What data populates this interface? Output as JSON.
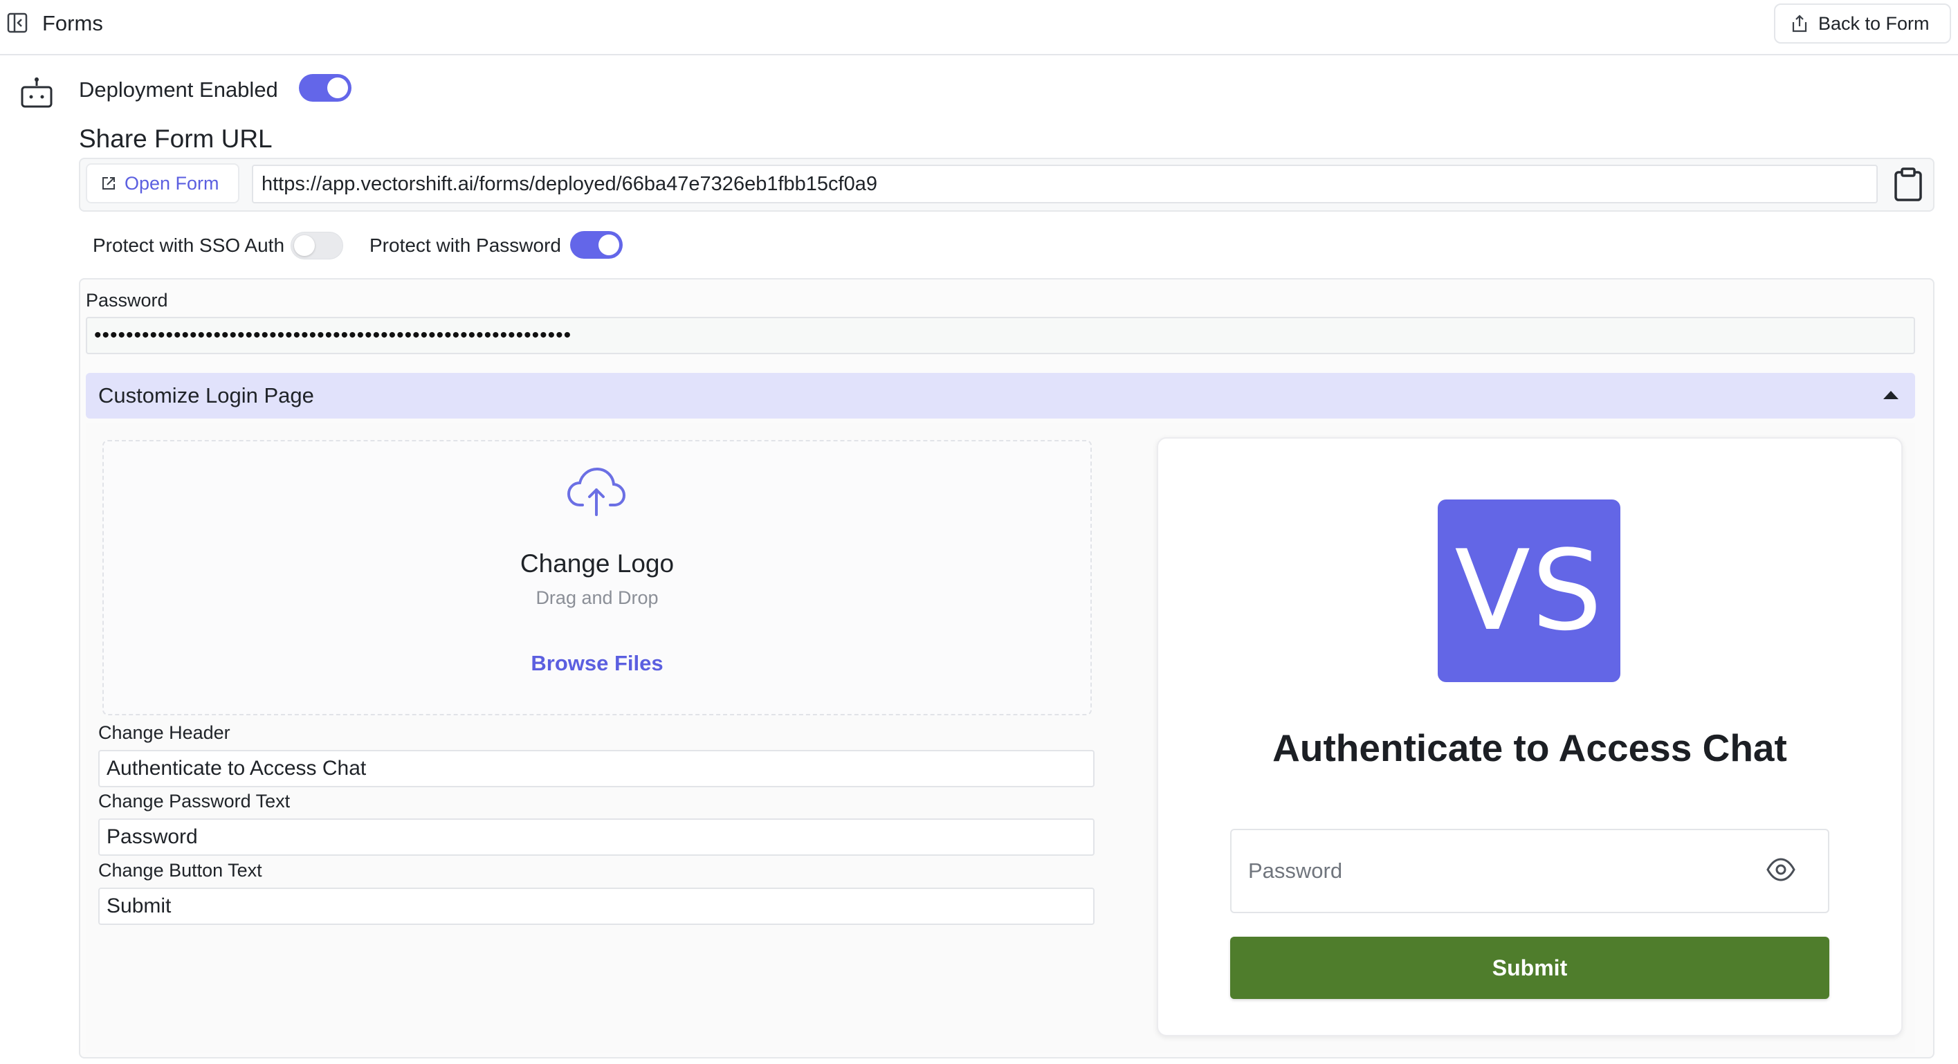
{
  "topbar": {
    "title": "Forms",
    "back_label": "Back to Form"
  },
  "deployment": {
    "label": "Deployment Enabled",
    "enabled": true
  },
  "share": {
    "title": "Share Form URL",
    "open_label": "Open Form",
    "url": "https://app.vectorshift.ai/forms/deployed/66ba47e7326eb1fbb15cf0a9"
  },
  "protection": {
    "sso_label": "Protect with SSO Auth",
    "sso_enabled": false,
    "password_label": "Protect with Password",
    "password_enabled": true
  },
  "password": {
    "caption": "Password",
    "masked_value": "••••••••••••••••••••••••••••••••••••••••••••••••••••••••••••"
  },
  "customize": {
    "title": "Customize Login Page",
    "upload": {
      "title": "Change Logo",
      "subtitle": "Drag and Drop",
      "browse_label": "Browse Files"
    },
    "header_label": "Change Header",
    "header_value": "Authenticate to Access Chat",
    "password_text_label": "Change Password Text",
    "password_text_value": "Password",
    "button_text_label": "Change Button Text",
    "button_text_value": "Submit"
  },
  "preview": {
    "logo_text": "VS",
    "title": "Authenticate to Access Chat",
    "password_placeholder": "Password",
    "submit_label": "Submit"
  },
  "colors": {
    "accent": "#6366e9",
    "submit_green": "#4f7d2c",
    "customize_bar": "#e1e2fb"
  }
}
